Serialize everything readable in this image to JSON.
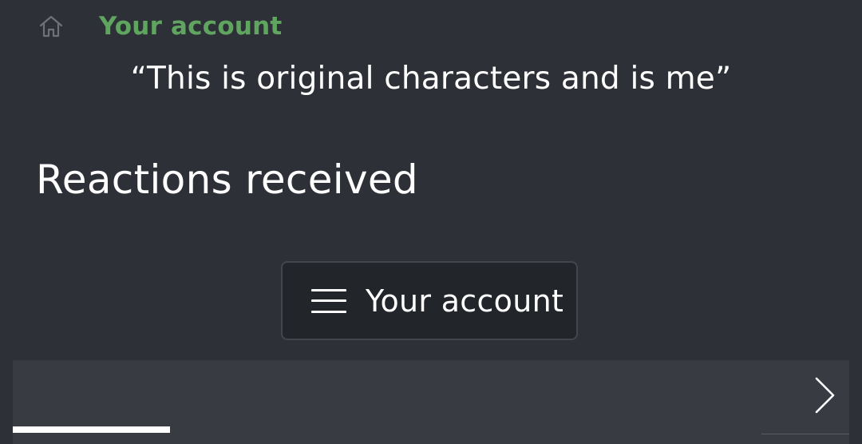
{
  "breadcrumb": {
    "home_icon": "home-icon",
    "link_label": "Your account"
  },
  "header": {
    "subtitle": "“This is original characters and is me”",
    "title": "Reactions received"
  },
  "menu": {
    "icon": "hamburger-menu-icon",
    "label": "Your account"
  },
  "tabs": {
    "scroll_icon": "chevron-right-icon"
  },
  "colors": {
    "background": "#2e3037",
    "accent": "#5fa55f",
    "button_bg": "#22252a",
    "tab_strip_bg": "#393b43"
  }
}
